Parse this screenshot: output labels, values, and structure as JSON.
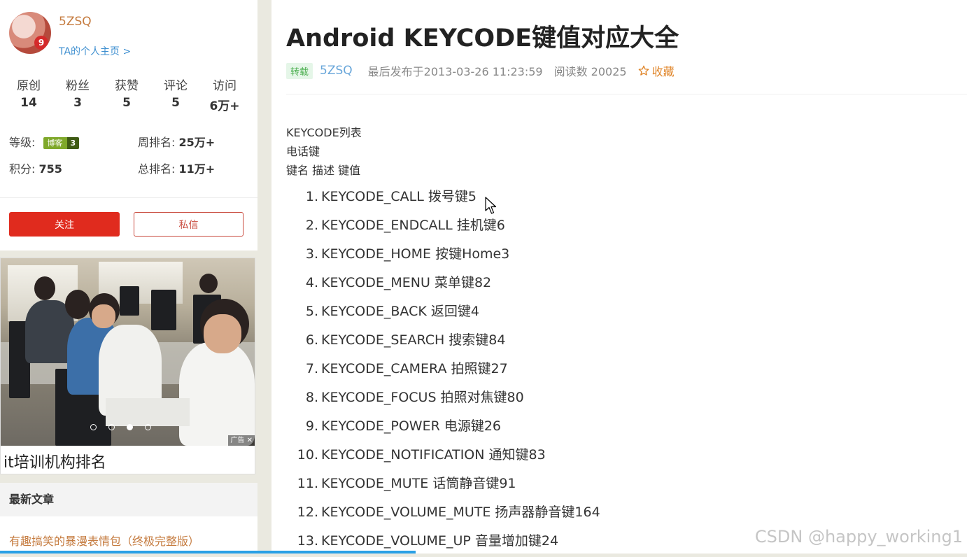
{
  "profile": {
    "name": "5ZSQ",
    "home_link": "TA的个人主页 >",
    "avatar_badge": "9",
    "stats": [
      {
        "label": "原创",
        "value": "14"
      },
      {
        "label": "粉丝",
        "value": "3"
      },
      {
        "label": "获赞",
        "value": "5"
      },
      {
        "label": "评论",
        "value": "5"
      },
      {
        "label": "访问",
        "value": "6万+"
      }
    ],
    "level_label": "等级:",
    "level_badge_text": "博客",
    "level_badge_num": "3",
    "week_rank_label": "周排名:",
    "week_rank_value": "25万+",
    "points_label": "积分:",
    "points_value": "755",
    "total_rank_label": "总排名:",
    "total_rank_value": "11万+",
    "follow_label": "关注",
    "message_label": "私信"
  },
  "ad": {
    "title": "it培训机构排名",
    "tag": "广告",
    "close": "✕",
    "slides": 4,
    "active_slide": 2
  },
  "latest": {
    "heading": "最新文章",
    "first_article": "有趣搞笑的暴漫表情包（终极完整版）"
  },
  "article": {
    "title": "Android KEYCODE键值对应大全",
    "repost_tag": "转载",
    "author": "5ZSQ",
    "published": "最后发布于2013-03-26 11:23:59",
    "reads": "阅读数 20025",
    "favorite": "收藏",
    "intro_lines": [
      "KEYCODE列表",
      "电话键",
      "键名 描述 键值"
    ],
    "keys": [
      {
        "num": "1.",
        "text": "KEYCODE_CALL 拨号键5"
      },
      {
        "num": "2.",
        "text": "KEYCODE_ENDCALL 挂机键6"
      },
      {
        "num": "3.",
        "text": "KEYCODE_HOME 按键Home3"
      },
      {
        "num": "4.",
        "text": "KEYCODE_MENU 菜单键82"
      },
      {
        "num": "5.",
        "text": "KEYCODE_BACK 返回键4"
      },
      {
        "num": "6.",
        "text": "KEYCODE_SEARCH 搜索键84"
      },
      {
        "num": "7.",
        "text": "KEYCODE_CAMERA 拍照键27"
      },
      {
        "num": "8.",
        "text": "KEYCODE_FOCUS 拍照对焦键80"
      },
      {
        "num": "9.",
        "text": "KEYCODE_POWER 电源键26"
      },
      {
        "num": "10.",
        "text": "KEYCODE_NOTIFICATION 通知键83"
      },
      {
        "num": "11.",
        "text": "KEYCODE_MUTE 话筒静音键91"
      },
      {
        "num": "12.",
        "text": "KEYCODE_VOLUME_MUTE 扬声器静音键164"
      },
      {
        "num": "13.",
        "text": "KEYCODE_VOLUME_UP 音量增加键24"
      }
    ]
  },
  "watermark": "CSDN @happy_working1",
  "page_load_progress": 0.43,
  "colors": {
    "accent_red": "#e02b1e",
    "author_orange": "#c57b3f",
    "link_blue": "#3e8fd0",
    "progress_blue": "#2aa0e5"
  }
}
